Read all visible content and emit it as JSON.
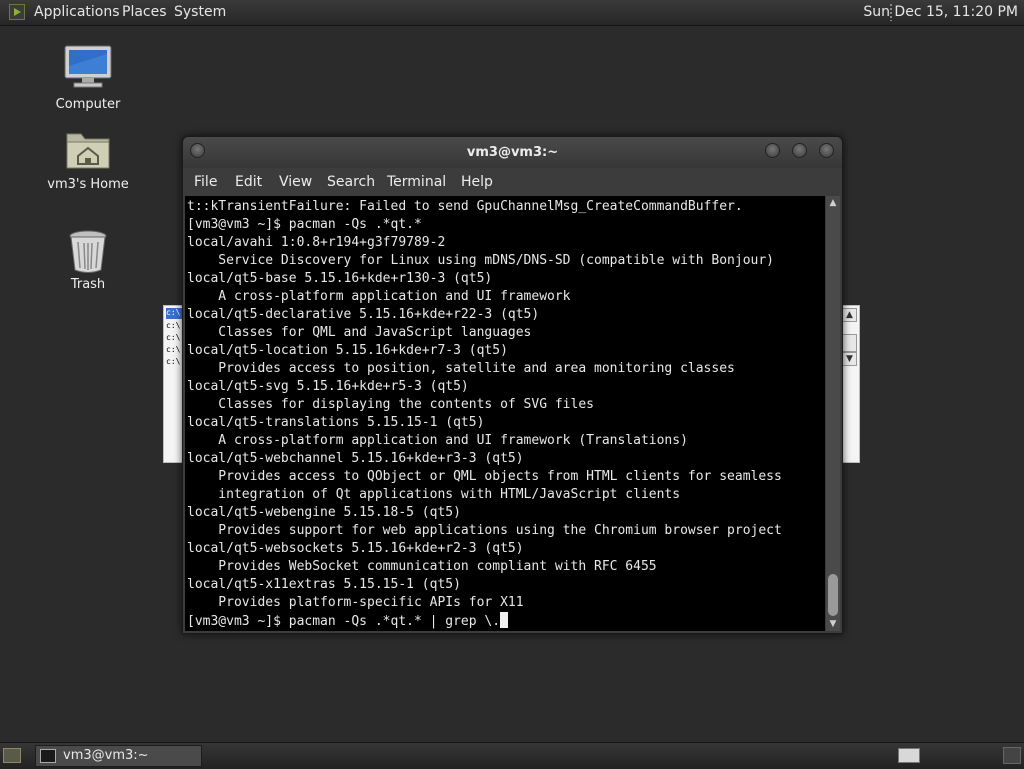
{
  "top_panel": {
    "menus": [
      "Applications",
      "Places",
      "System"
    ],
    "clock": "Sun Dec 15, 11:20 PM"
  },
  "desktop_icons": [
    {
      "label": "Computer",
      "icon": "computer-icon"
    },
    {
      "label": "vm3's Home",
      "icon": "home-folder-icon"
    },
    {
      "label": "Trash",
      "icon": "trash-icon"
    }
  ],
  "background_window": {
    "rows": [
      "c:\\",
      "c:\\",
      "c:\\",
      "c:\\",
      "c:\\"
    ]
  },
  "terminal": {
    "title": "vm3@vm3:~",
    "menu": [
      "File",
      "Edit",
      "View",
      "Search",
      "Terminal",
      "Help"
    ],
    "lines": [
      "t::kTransientFailure: Failed to send GpuChannelMsg_CreateCommandBuffer.",
      "[vm3@vm3 ~]$ pacman -Qs .*qt.*",
      "local/avahi 1:0.8+r194+g3f79789-2",
      "    Service Discovery for Linux using mDNS/DNS-SD (compatible with Bonjour)",
      "local/qt5-base 5.15.16+kde+r130-3 (qt5)",
      "    A cross-platform application and UI framework",
      "local/qt5-declarative 5.15.16+kde+r22-3 (qt5)",
      "    Classes for QML and JavaScript languages",
      "local/qt5-location 5.15.16+kde+r7-3 (qt5)",
      "    Provides access to position, satellite and area monitoring classes",
      "local/qt5-svg 5.15.16+kde+r5-3 (qt5)",
      "    Classes for displaying the contents of SVG files",
      "local/qt5-translations 5.15.15-1 (qt5)",
      "    A cross-platform application and UI framework (Translations)",
      "local/qt5-webchannel 5.15.16+kde+r3-3 (qt5)",
      "    Provides access to QObject or QML objects from HTML clients for seamless",
      "    integration of Qt applications with HTML/JavaScript clients",
      "local/qt5-webengine 5.15.18-5 (qt5)",
      "    Provides support for web applications using the Chromium browser project",
      "local/qt5-websockets 5.15.16+kde+r2-3 (qt5)",
      "    Provides WebSocket communication compliant with RFC 6455",
      "local/qt5-x11extras 5.15.15-1 (qt5)",
      "    Provides platform-specific APIs for X11"
    ],
    "prompt_line": "[vm3@vm3 ~]$ pacman -Qs .*qt.* | grep \\."
  },
  "bottom_panel": {
    "task_label": "vm3@vm3:~"
  }
}
